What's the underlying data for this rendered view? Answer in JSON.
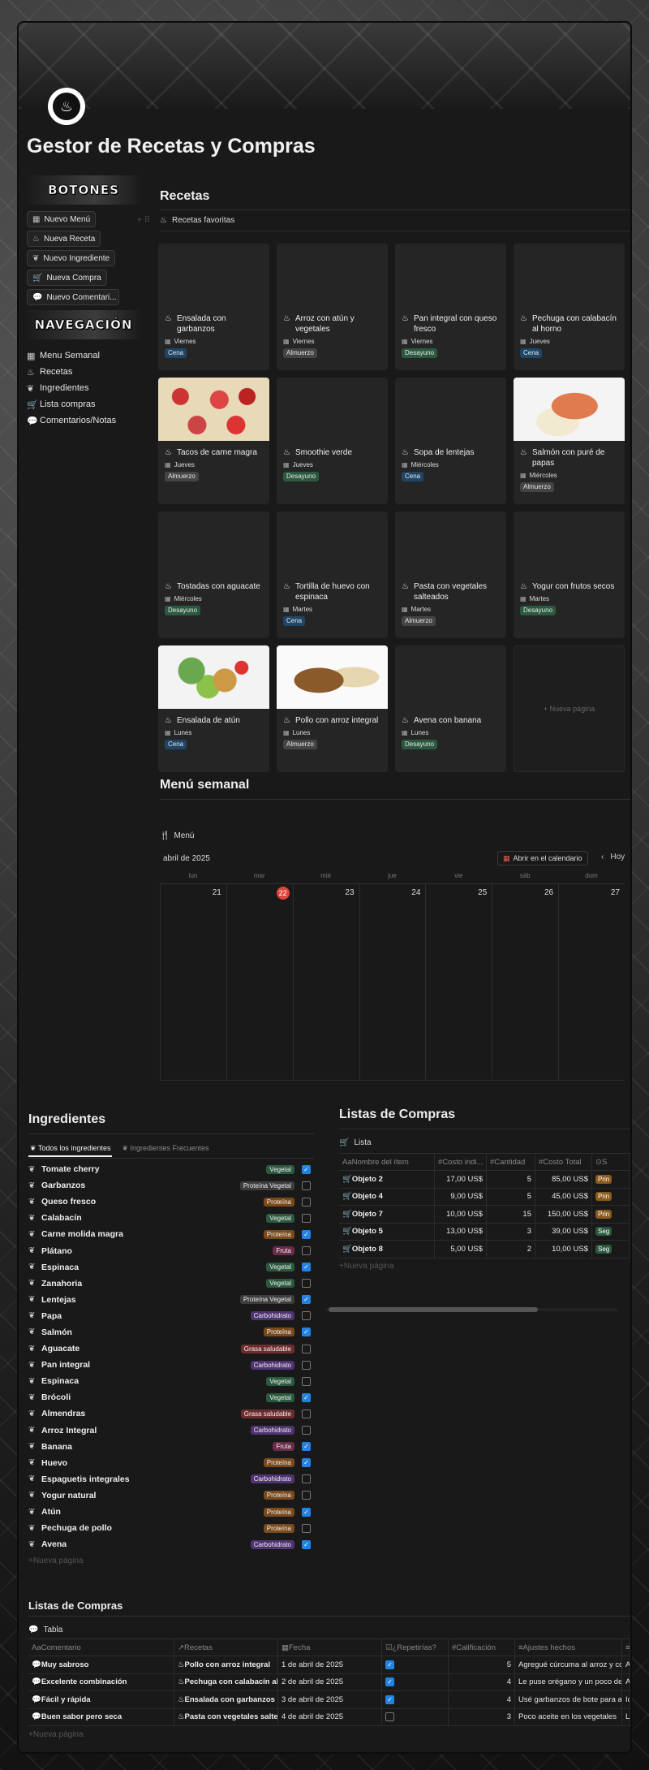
{
  "page": {
    "title": "Gestor de Recetas y Compras"
  },
  "sidebar": {
    "buttons_banner": "BOTONES",
    "buttons": [
      {
        "label": "Nuevo Menú",
        "icon": "calendar-icon"
      },
      {
        "label": "Nueva Receta",
        "icon": "dish-icon"
      },
      {
        "label": "Nuevo Ingrediente",
        "icon": "ingredient-icon"
      },
      {
        "label": "Nueva Compra",
        "icon": "cart-icon"
      },
      {
        "label": "Nuevo Comentari...",
        "icon": "comment-icon"
      }
    ],
    "nav_banner": "NAVEGACIÓN",
    "nav": [
      {
        "label": "Menu Semanal",
        "icon": "calendar-icon"
      },
      {
        "label": "Recetas",
        "icon": "dish-icon"
      },
      {
        "label": "Ingredientes",
        "icon": "ingredient-icon"
      },
      {
        "label": "Lista compras",
        "icon": "cart-icon"
      },
      {
        "label": "Comentarios/Notas",
        "icon": "comment-icon"
      }
    ]
  },
  "recetas": {
    "heading": "Recetas",
    "view_label": "Recetas favoritas",
    "new_page": "Nueva página",
    "cards": [
      {
        "title": "Ensalada con garbanzos",
        "day": "Viernes",
        "tag": "Cena",
        "tag_kind": "cena",
        "img": ""
      },
      {
        "title": "Arroz con atún y vegetales",
        "day": "Viernes",
        "tag": "Almuerzo",
        "tag_kind": "alm",
        "img": ""
      },
      {
        "title": "Pan integral con queso fresco",
        "day": "Viernes",
        "tag": "Desayuno",
        "tag_kind": "des",
        "img": ""
      },
      {
        "title": "Pechuga con calabacín al horno",
        "day": "Jueves",
        "tag": "Cena",
        "tag_kind": "cena",
        "img": ""
      },
      {
        "title": "Tacos de carne magra",
        "day": "Jueves",
        "tag": "Almuerzo",
        "tag_kind": "alm",
        "img": "food1"
      },
      {
        "title": "Smoothie verde",
        "day": "Jueves",
        "tag": "Desayuno",
        "tag_kind": "des",
        "img": ""
      },
      {
        "title": "Sopa de lentejas",
        "day": "Miércoles",
        "tag": "Cena",
        "tag_kind": "cena",
        "img": ""
      },
      {
        "title": "Salmón con puré de papas",
        "day": "Miércoles",
        "tag": "Almuerzo",
        "tag_kind": "alm",
        "img": "food2"
      },
      {
        "title": "Tostadas con aguacate",
        "day": "Miércoles",
        "tag": "Desayuno",
        "tag_kind": "des",
        "img": ""
      },
      {
        "title": "Tortilla de huevo con espinaca",
        "day": "Martes",
        "tag": "Cena",
        "tag_kind": "cena",
        "img": ""
      },
      {
        "title": "Pasta con vegetales salteados",
        "day": "Martes",
        "tag": "Almuerzo",
        "tag_kind": "alm",
        "img": ""
      },
      {
        "title": "Yogur con frutos secos",
        "day": "Martes",
        "tag": "Desayuno",
        "tag_kind": "des",
        "img": ""
      },
      {
        "title": "Ensalada de atún",
        "day": "Lunes",
        "tag": "Cena",
        "tag_kind": "cena",
        "img": "food3"
      },
      {
        "title": "Pollo con arroz integral",
        "day": "Lunes",
        "tag": "Almuerzo",
        "tag_kind": "alm",
        "img": "food4"
      },
      {
        "title": "Avena con banana",
        "day": "Lunes",
        "tag": "Desayuno",
        "tag_kind": "des",
        "img": ""
      }
    ]
  },
  "menu": {
    "heading": "Menú semanal",
    "view_label": "Menú",
    "month": "abril de 2025",
    "open_calendar": "Abrir en el calendario",
    "today": "Hoy",
    "weekdays": [
      "lun",
      "mar",
      "mié",
      "jue",
      "vie",
      "sáb",
      "dom"
    ],
    "days": [
      "21",
      "22",
      "23",
      "24",
      "25",
      "26",
      "27"
    ],
    "today_index": 1
  },
  "ingredientes": {
    "heading": "Ingredientes",
    "tabs": [
      "Todos los ingredientes",
      "Ingredientes Frecuentes"
    ],
    "new_page": "Nueva página",
    "items": [
      {
        "name": "Tomate cherry",
        "cat": "Vegetal",
        "kind": "veg",
        "checked": true
      },
      {
        "name": "Garbanzos",
        "cat": "Proteína Vegetal",
        "kind": "pveg",
        "checked": false
      },
      {
        "name": "Queso fresco",
        "cat": "Proteína",
        "kind": "prot",
        "checked": false
      },
      {
        "name": "Calabacín",
        "cat": "Vegetal",
        "kind": "veg",
        "checked": false
      },
      {
        "name": "Carne molida magra",
        "cat": "Proteína",
        "kind": "prot",
        "checked": true
      },
      {
        "name": "Plátano",
        "cat": "Fruta",
        "kind": "fruta",
        "checked": false
      },
      {
        "name": "Espinaca",
        "cat": "Vegetal",
        "kind": "veg",
        "checked": true
      },
      {
        "name": "Zanahoria",
        "cat": "Vegetal",
        "kind": "veg",
        "checked": false
      },
      {
        "name": "Lentejas",
        "cat": "Proteína Vegetal",
        "kind": "pveg",
        "checked": true
      },
      {
        "name": "Papa",
        "cat": "Carbohidrato",
        "kind": "carb",
        "checked": false
      },
      {
        "name": "Salmón",
        "cat": "Proteína",
        "kind": "prot",
        "checked": true
      },
      {
        "name": "Aguacate",
        "cat": "Grasa saludable",
        "kind": "grasa",
        "checked": false
      },
      {
        "name": "Pan integral",
        "cat": "Carbohidrato",
        "kind": "carb",
        "checked": false
      },
      {
        "name": "Espinaca",
        "cat": "Vegetal",
        "kind": "veg",
        "checked": false
      },
      {
        "name": "Brócoli",
        "cat": "Vegetal",
        "kind": "veg",
        "checked": true
      },
      {
        "name": "Almendras",
        "cat": "Grasa saludable",
        "kind": "grasa",
        "checked": false
      },
      {
        "name": "Arroz Integral",
        "cat": "Carbohidrato",
        "kind": "carb",
        "checked": false
      },
      {
        "name": "Banana",
        "cat": "Fruta",
        "kind": "fruta",
        "checked": true
      },
      {
        "name": "Huevo",
        "cat": "Proteína",
        "kind": "prot",
        "checked": true
      },
      {
        "name": "Espaguetis integrales",
        "cat": "Carbohidrato",
        "kind": "carb",
        "checked": false
      },
      {
        "name": "Yogur natural",
        "cat": "Proteína",
        "kind": "prot",
        "checked": false
      },
      {
        "name": "Atún",
        "cat": "Proteína",
        "kind": "prot",
        "checked": true
      },
      {
        "name": "Pechuga de pollo",
        "cat": "Proteína",
        "kind": "prot",
        "checked": false
      },
      {
        "name": "Avena",
        "cat": "Carbohidrato",
        "kind": "carb",
        "checked": true
      }
    ]
  },
  "compras": {
    "heading": "Listas de Compras",
    "view_label": "Lista",
    "new_page": "Nueva página",
    "columns": [
      "Nombre del ítem",
      "Costo indi...",
      "Cantidad",
      "Costo Total",
      "S"
    ],
    "rows": [
      {
        "name": "Objeto 2",
        "unit": "17,00 US$",
        "qty": "5",
        "total": "85,00 US$",
        "status": "Prin",
        "kind": "prio"
      },
      {
        "name": "Objeto 4",
        "unit": "9,00 US$",
        "qty": "5",
        "total": "45,00 US$",
        "status": "Prin",
        "kind": "prio"
      },
      {
        "name": "Objeto 7",
        "unit": "10,00 US$",
        "qty": "15",
        "total": "150,00 US$",
        "status": "Prin",
        "kind": "prio"
      },
      {
        "name": "Objeto 5",
        "unit": "13,00 US$",
        "qty": "3",
        "total": "39,00 US$",
        "status": "Seg",
        "kind": "seg"
      },
      {
        "name": "Objeto 8",
        "unit": "5,00 US$",
        "qty": "2",
        "total": "10,00 US$",
        "status": "Seg",
        "kind": "seg"
      }
    ]
  },
  "comentarios": {
    "heading": "Listas de Compras",
    "view_label": "Tabla",
    "new_page": "Nueva página",
    "columns": [
      "Comentario",
      "Recetas",
      "Fecha",
      "¿Repetirías?",
      "Calificación",
      "Ajustes hechos",
      ""
    ],
    "rows": [
      {
        "comment": "Muy sabroso",
        "recipe": "Pollo con arroz integral",
        "date": "1 de abril de 2025",
        "repeat": true,
        "rating": "5",
        "adjust": "Agregué cúrcuma al arroz y cor",
        "extra": "A t"
      },
      {
        "comment": "Excelente combinación",
        "recipe": "Pechuga con calabacín al h",
        "date": "2 de abril de 2025",
        "repeat": true,
        "rating": "4",
        "adjust": "Le puse orégano y un poco de l",
        "extra": "Ac"
      },
      {
        "comment": "Fácil y rápida",
        "recipe": "Ensalada con garbanzos",
        "date": "3 de abril de 2025",
        "repeat": true,
        "rating": "4",
        "adjust": "Usé garbanzos de bote para ah",
        "extra": "Ide"
      },
      {
        "comment": "Buen sabor pero seca",
        "recipe": "Pasta con vegetales salteac",
        "date": "4 de abril de 2025",
        "repeat": false,
        "rating": "3",
        "adjust": "Poco aceite en los vegetales",
        "extra": "Le"
      }
    ]
  }
}
